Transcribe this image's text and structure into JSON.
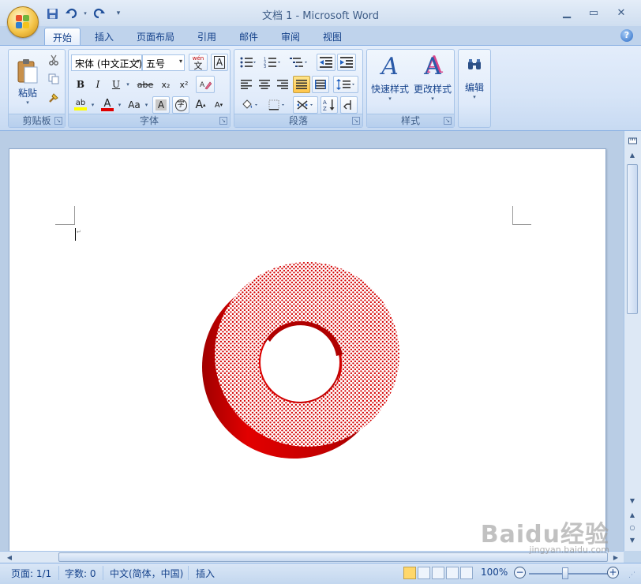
{
  "window": {
    "title": "文档 1 - Microsoft Word",
    "minimize_glyph": "▁",
    "maximize_glyph": "▭",
    "close_glyph": "✕",
    "help_glyph": "?"
  },
  "quick_access": {
    "items": [
      "save-icon",
      "undo-icon",
      "redo-icon",
      "customize-icon"
    ]
  },
  "tabs": [
    {
      "label": "开始",
      "active": true
    },
    {
      "label": "插入",
      "active": false
    },
    {
      "label": "页面布局",
      "active": false
    },
    {
      "label": "引用",
      "active": false
    },
    {
      "label": "邮件",
      "active": false
    },
    {
      "label": "审阅",
      "active": false
    },
    {
      "label": "视图",
      "active": false
    }
  ],
  "ribbon": {
    "clipboard": {
      "label": "剪贴板",
      "paste_label": "粘贴"
    },
    "font": {
      "label": "字体",
      "font_name": "宋体 (中文正文)",
      "font_size": "五号",
      "bold": "B",
      "italic": "I",
      "underline": "U",
      "strikethrough": "abe",
      "subscript": "x₂",
      "superscript": "x²",
      "case": "Aa",
      "grow": "A",
      "shrink": "A",
      "char_shading": "A",
      "enclose": "字",
      "phonetic": "wén",
      "phonetic_base": "文",
      "border_a": "A",
      "highlight": "ab",
      "font_color": "A"
    },
    "paragraph": {
      "label": "段落"
    },
    "styles": {
      "label": "样式",
      "quick_styles": "快速样式",
      "change_styles": "更改样式",
      "icon_glyph": "A"
    },
    "editing": {
      "label": "编辑"
    }
  },
  "status_bar": {
    "page": "页面: 1/1",
    "word_count": "字数: 0",
    "language": "中文(简体，中国)",
    "mode": "插入",
    "zoom": "100%",
    "zoom_minus": "−",
    "zoom_plus": "+"
  },
  "colors": {
    "shape_red": "#d40000",
    "shape_dark_red": "#9a0000",
    "highlight_yellow": "#ffff00",
    "font_red": "#e00000"
  },
  "watermark": {
    "text": "Baidu经验",
    "sub": "jingyan.baidu.com"
  }
}
